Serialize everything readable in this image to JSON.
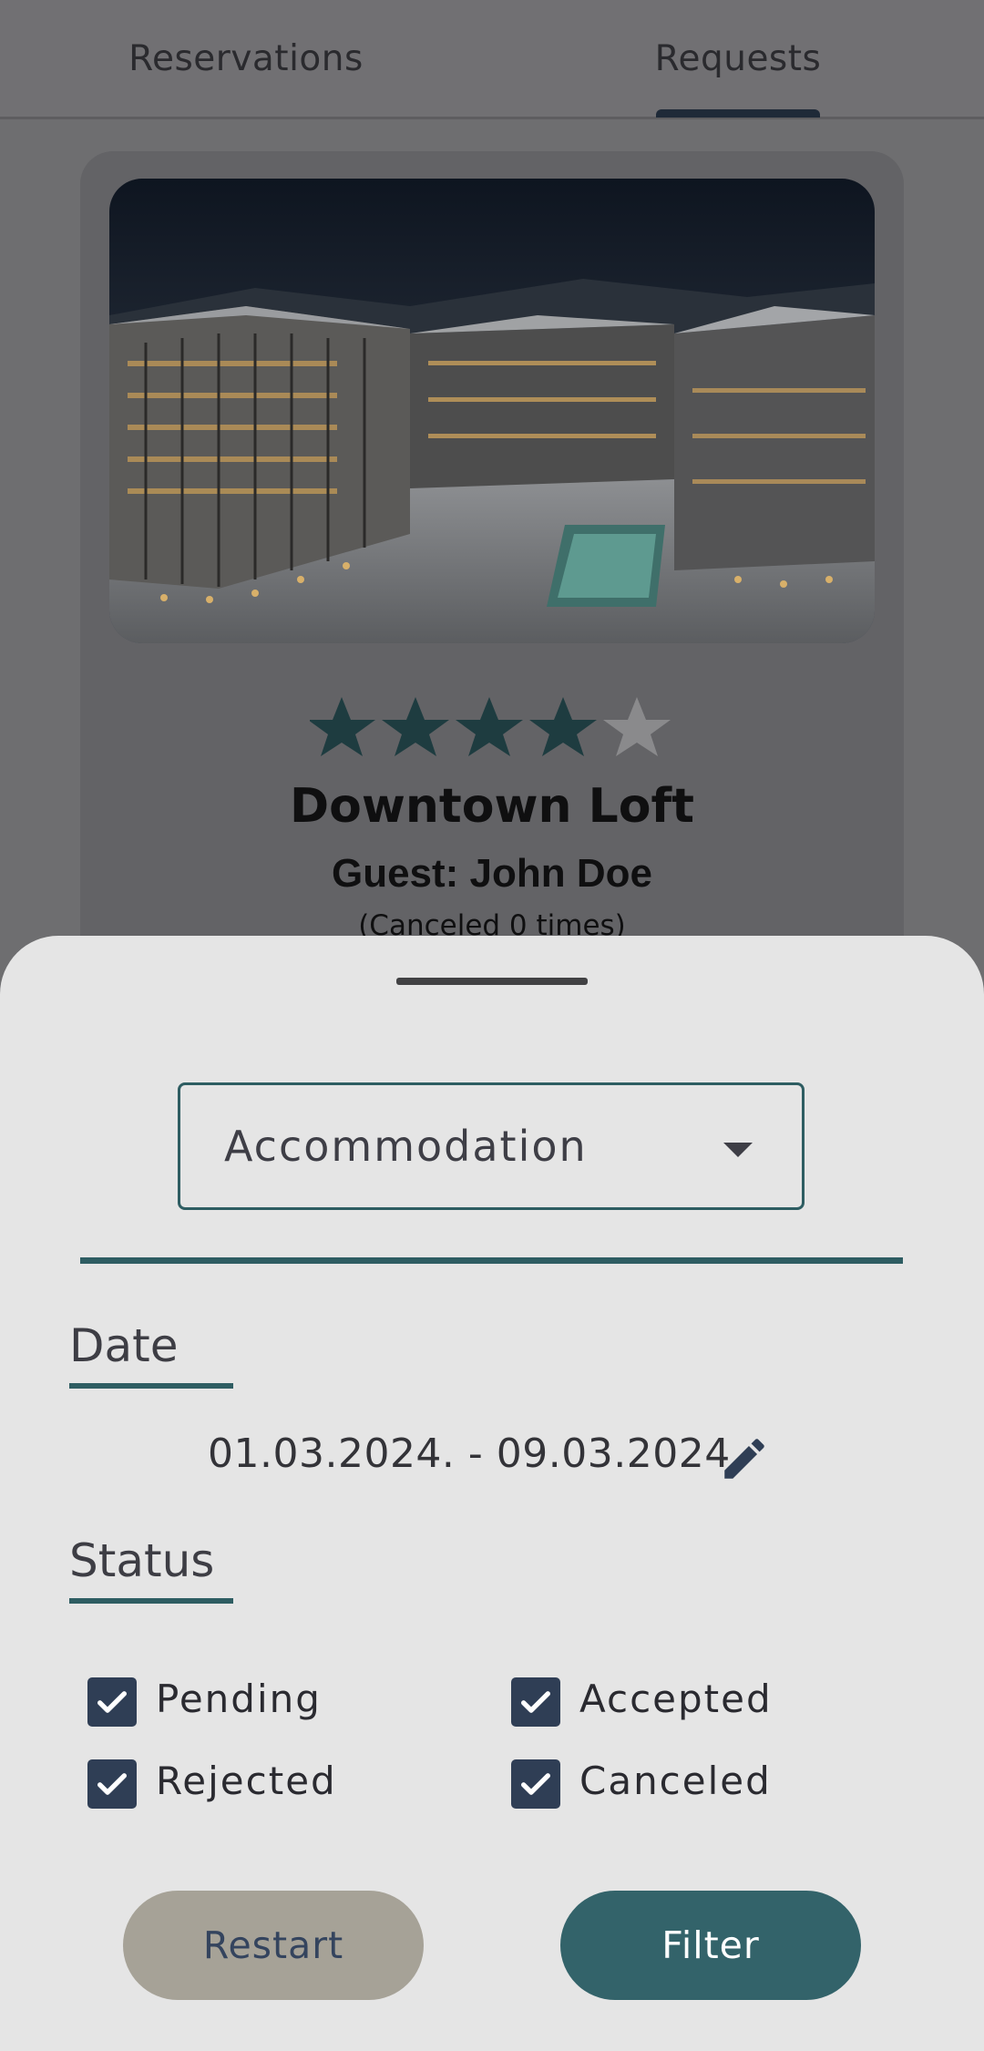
{
  "tabs": [
    {
      "label": "Reservations"
    },
    {
      "label": "Requests"
    }
  ],
  "card": {
    "rating": 4,
    "rating_max": 5,
    "title": "Downtown Loft",
    "guest": "Guest: John Doe",
    "canceled": "(Canceled 0 times)"
  },
  "filter": {
    "accommodation_value": "Accommodation",
    "date_title": "Date",
    "date_range": "01.03.2024. - 09.03.2024.",
    "status_title": "Status",
    "statuses": [
      {
        "label": "Pending",
        "checked": true
      },
      {
        "label": "Accepted",
        "checked": true
      },
      {
        "label": "Rejected",
        "checked": true
      },
      {
        "label": "Canceled",
        "checked": true
      }
    ],
    "restart_label": "Restart",
    "filter_label": "Filter"
  },
  "colors": {
    "accent": "#2e5d62",
    "checkbox": "#2f3e55",
    "restart_bg": "#a6a297",
    "filter_bg": "#33636a",
    "star_on": "#1e3c40",
    "star_off": "#8a8a8c"
  }
}
